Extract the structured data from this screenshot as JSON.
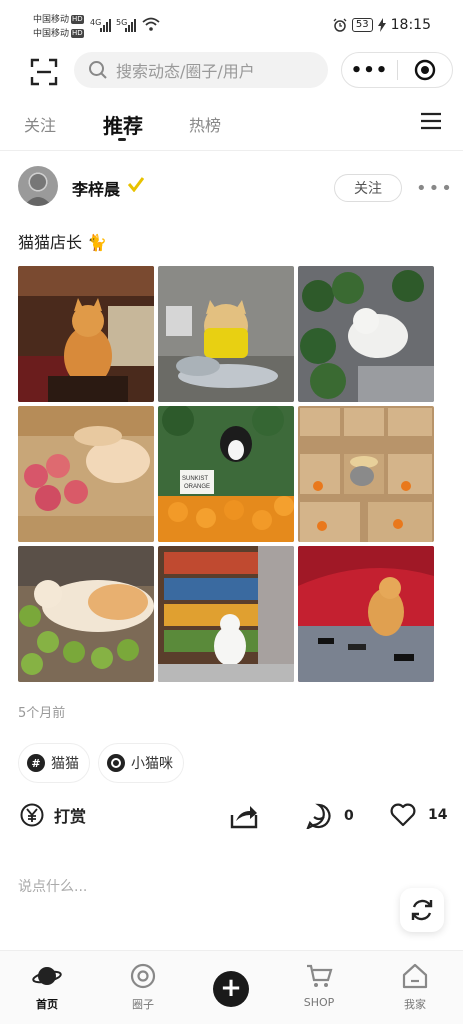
{
  "status_bar": {
    "carrier1": "中国移动",
    "carrier2": "中国移动",
    "hd": "HD",
    "net1": "4G",
    "net2": "5G",
    "battery": "53",
    "time": "18:15"
  },
  "top_bar": {
    "search_placeholder": "搜索动态/圈子/用户",
    "more_label": "•••"
  },
  "tabs": [
    {
      "label": "关注"
    },
    {
      "label": "推荐"
    },
    {
      "label": "热榜"
    }
  ],
  "post": {
    "username": "李梓晨",
    "follow_label": "关注",
    "more_label": "•••",
    "text": "猫猫店长 🐈",
    "time_ago": "5个月前",
    "tags": [
      {
        "label": "猫猫"
      },
      {
        "label": "小猫咪"
      }
    ],
    "reward_label": "打赏",
    "comment_count": "0",
    "like_count": "14",
    "comment_placeholder": "说点什么...",
    "photo_signs": {
      "orange_box": "SUNKIST\nORANGE\n6 FOR $..."
    }
  },
  "bottom_nav": [
    {
      "label": "首页"
    },
    {
      "label": "圈子"
    },
    {
      "label": ""
    },
    {
      "label": "SHOP"
    },
    {
      "label": "我家"
    }
  ],
  "colors": {
    "accent": "#e8c200",
    "dark": "#1a1a1a"
  }
}
